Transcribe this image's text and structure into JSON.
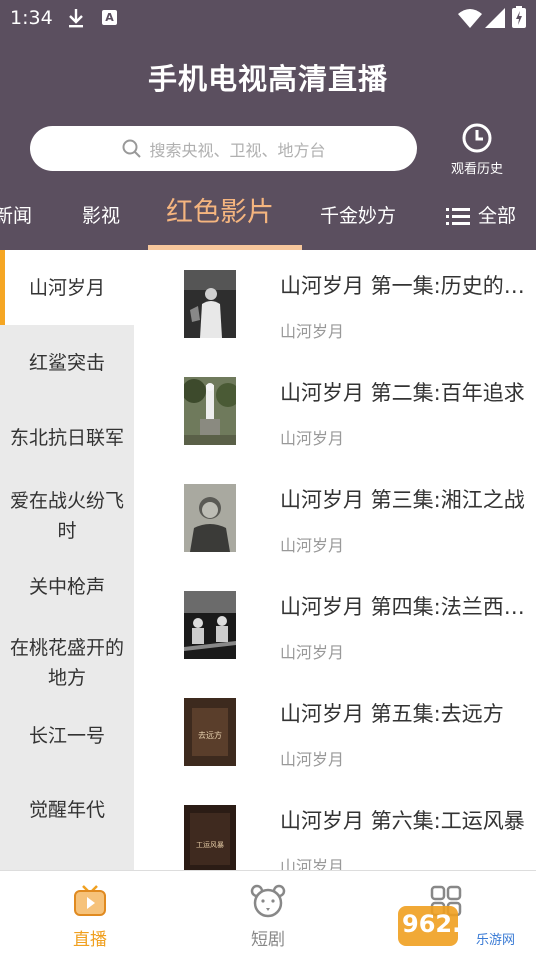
{
  "status_bar": {
    "time": "1:34"
  },
  "header": {
    "title": "手机电视高清直播",
    "search_placeholder": "搜索央视、卫视、地方台",
    "history_label": "观看历史"
  },
  "tabs": [
    {
      "label": "新闻"
    },
    {
      "label": "影视"
    },
    {
      "label": "红色影片"
    },
    {
      "label": "千金妙方"
    },
    {
      "label": "全部"
    }
  ],
  "sidebar": {
    "items": [
      {
        "label": "山河岁月"
      },
      {
        "label": "红鲨突击"
      },
      {
        "label": "东北抗日联军"
      },
      {
        "label": "爱在战火纷飞时"
      },
      {
        "label": "关中枪声"
      },
      {
        "label": "在桃花盛开的地方"
      },
      {
        "label": "长江一号"
      },
      {
        "label": "觉醒年代"
      }
    ]
  },
  "episodes": [
    {
      "title": "山河岁月 第一集:历史的选择",
      "subtitle": "山河岁月"
    },
    {
      "title": "山河岁月 第二集:百年追求",
      "subtitle": "山河岁月"
    },
    {
      "title": "山河岁月 第三集:湘江之战",
      "subtitle": "山河岁月"
    },
    {
      "title": "山河岁月 第四集:法兰西之春",
      "subtitle": "山河岁月"
    },
    {
      "title": "山河岁月 第五集:去远方",
      "subtitle": "山河岁月"
    },
    {
      "title": "山河岁月 第六集:工运风暴",
      "subtitle": "山河岁月"
    }
  ],
  "thumb_captions": {
    "ep5": "去远方",
    "ep6": "工运风暴"
  },
  "bottom_nav": [
    {
      "label": "直播",
      "icon": "tv-icon"
    },
    {
      "label": "短剧",
      "icon": "bear-icon"
    },
    {
      "label": "",
      "icon": "grid-icon"
    }
  ],
  "watermark": {
    "text": "962.NET",
    "sub": "乐游网"
  },
  "colors": {
    "header_bg": "#5b4f5f",
    "accent": "#f5a623",
    "active_tab": "#f5b57f"
  }
}
